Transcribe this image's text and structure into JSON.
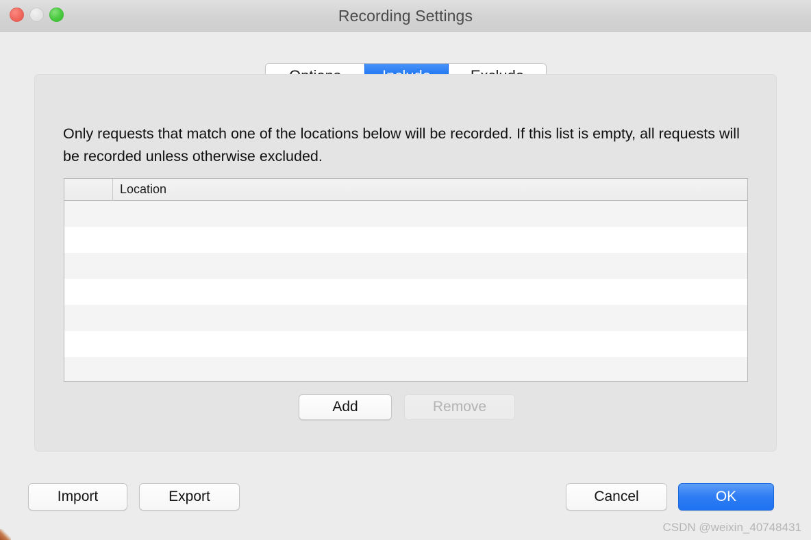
{
  "window": {
    "title": "Recording Settings",
    "traffic_lights": [
      {
        "name": "close",
        "color": "#f0685e",
        "enabled": true
      },
      {
        "name": "minimize",
        "color": "#e3e3e3",
        "enabled": false
      },
      {
        "name": "zoom",
        "color": "#4ac93f",
        "enabled": true
      }
    ]
  },
  "tabs": [
    {
      "id": "options",
      "label": "Options",
      "selected": false
    },
    {
      "id": "include",
      "label": "Include",
      "selected": true
    },
    {
      "id": "exclude",
      "label": "Exclude",
      "selected": false
    }
  ],
  "panel": {
    "description": "Only requests that match one of the locations below will be recorded. If this list is empty, all requests will be recorded unless otherwise excluded."
  },
  "table": {
    "columns": [
      {
        "id": "enabled",
        "header": ""
      },
      {
        "id": "location",
        "header": "Location"
      }
    ],
    "rows": [],
    "empty_row_count": 7,
    "stripe_colors": {
      "odd": "#f4f4f4",
      "even": "#ffffff"
    }
  },
  "list_buttons": {
    "add_label": "Add",
    "add_enabled": "true",
    "remove_label": "Remove",
    "remove_enabled": "false"
  },
  "footer_buttons": {
    "import_label": "Import",
    "export_label": "Export",
    "cancel_label": "Cancel",
    "ok_label": "OK"
  },
  "watermark": {
    "text": "CSDN @weixin_40748431"
  },
  "colors": {
    "window_background": "#ececec",
    "panel_background": "#e4e4e4",
    "titlebar_background": "#d3d3d3",
    "accent": "#1f72f1",
    "selected_tab": "#1a74f2"
  }
}
